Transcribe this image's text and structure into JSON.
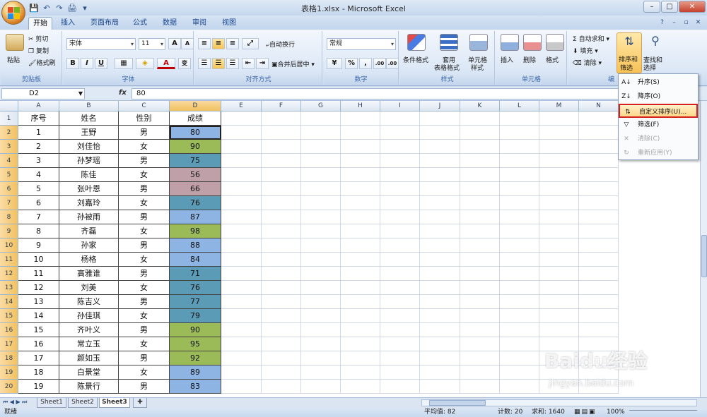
{
  "window": {
    "title": "表格1.xlsx - Microsoft Excel"
  },
  "tabs": [
    "开始",
    "插入",
    "页面布局",
    "公式",
    "数据",
    "审阅",
    "视图"
  ],
  "ribbon": {
    "clipboard": {
      "label": "剪贴板",
      "paste": "粘贴",
      "cut": "剪切",
      "copy": "复制",
      "format_painter": "格式刷"
    },
    "font": {
      "label": "字体",
      "name": "宋体",
      "size": "11",
      "bold": "B",
      "italic": "I",
      "underline": "U",
      "grow": "A",
      "shrink": "A",
      "color_letter": "A",
      "phonetic": "变"
    },
    "alignment": {
      "label": "对齐方式",
      "wrap": "自动换行",
      "merge": "合并后居中"
    },
    "number": {
      "label": "数字",
      "format": "常规",
      "percent": "%",
      "comma": ",",
      "inc_decimal": ".00",
      "dec_decimal": ".00"
    },
    "styles": {
      "label": "样式",
      "conditional": "条件格式",
      "table_line1": "套用",
      "table_line2": "表格格式",
      "cell_line1": "单元格",
      "cell_line2": "样式"
    },
    "cells": {
      "label": "单元格",
      "insert": "插入",
      "delete": "删除",
      "format": "格式"
    },
    "editing": {
      "label": "编",
      "autosum": "自动求和",
      "fill": "填充",
      "clear": "清除",
      "sort_line1": "排序和",
      "sort_line2": "筛选",
      "find_line1": "查找和",
      "find_line2": "选择"
    }
  },
  "formula_bar": {
    "name_box": "D2",
    "fx": "fx",
    "value": "80"
  },
  "columns": [
    "A",
    "B",
    "C",
    "D",
    "E",
    "F",
    "G",
    "H",
    "I",
    "J",
    "K",
    "L",
    "M",
    "N"
  ],
  "headers": [
    "序号",
    "姓名",
    "性别",
    "成绩"
  ],
  "rows": [
    {
      "n": "1",
      "name": "王野",
      "sex": "男",
      "score": "80",
      "color": "#8eb4e3"
    },
    {
      "n": "2",
      "name": "刘佳怡",
      "sex": "女",
      "score": "90",
      "color": "#9bbb59"
    },
    {
      "n": "3",
      "name": "孙梦瑶",
      "sex": "男",
      "score": "75",
      "color": "#5b9bb5"
    },
    {
      "n": "4",
      "name": "陈佳",
      "sex": "女",
      "score": "56",
      "color": "#c0a0a8"
    },
    {
      "n": "5",
      "name": "张叶恩",
      "sex": "男",
      "score": "66",
      "color": "#c0a0a8"
    },
    {
      "n": "6",
      "name": "刘嘉玲",
      "sex": "女",
      "score": "76",
      "color": "#5b9bb5"
    },
    {
      "n": "7",
      "name": "孙被雨",
      "sex": "男",
      "score": "87",
      "color": "#8eb4e3"
    },
    {
      "n": "8",
      "name": "齐磊",
      "sex": "女",
      "score": "98",
      "color": "#9bbb59"
    },
    {
      "n": "9",
      "name": "孙家",
      "sex": "男",
      "score": "88",
      "color": "#8eb4e3"
    },
    {
      "n": "10",
      "name": "杨格",
      "sex": "女",
      "score": "84",
      "color": "#8eb4e3"
    },
    {
      "n": "11",
      "name": "高雅谁",
      "sex": "男",
      "score": "71",
      "color": "#5b9bb5"
    },
    {
      "n": "12",
      "name": "刘美",
      "sex": "女",
      "score": "76",
      "color": "#5b9bb5"
    },
    {
      "n": "13",
      "name": "陈吉义",
      "sex": "男",
      "score": "77",
      "color": "#5b9bb5"
    },
    {
      "n": "14",
      "name": "孙佳琪",
      "sex": "女",
      "score": "79",
      "color": "#5b9bb5"
    },
    {
      "n": "15",
      "name": "齐叶义",
      "sex": "男",
      "score": "90",
      "color": "#9bbb59"
    },
    {
      "n": "16",
      "name": "常立玉",
      "sex": "女",
      "score": "95",
      "color": "#9bbb59"
    },
    {
      "n": "17",
      "name": "颜如玉",
      "sex": "男",
      "score": "92",
      "color": "#9bbb59"
    },
    {
      "n": "18",
      "name": "白景堂",
      "sex": "女",
      "score": "89",
      "color": "#8eb4e3"
    },
    {
      "n": "19",
      "name": "陈景行",
      "sex": "男",
      "score": "83",
      "color": "#8eb4e3"
    }
  ],
  "sheets": [
    "Sheet1",
    "Sheet2",
    "Sheet3"
  ],
  "sort_menu": [
    {
      "label": "升序(S)",
      "icon": "A↓",
      "disabled": false,
      "highlight": false
    },
    {
      "label": "降序(O)",
      "icon": "Z↓",
      "disabled": false,
      "highlight": false
    },
    {
      "label": "自定义排序(U)...",
      "icon": "⇅",
      "disabled": false,
      "highlight": true
    },
    {
      "label": "筛选(F)",
      "icon": "▽",
      "disabled": false,
      "highlight": false
    },
    {
      "label": "清除(C)",
      "icon": "✕",
      "disabled": true,
      "highlight": false
    },
    {
      "label": "重新应用(Y)",
      "icon": "↻",
      "disabled": true,
      "highlight": false
    }
  ],
  "status": {
    "ready": "就绪",
    "average": "平均值: 82",
    "count": "计数: 20",
    "sum": "求和: 1640",
    "zoom": "100%"
  },
  "watermark": {
    "brand": "Baidu经验",
    "url": "jingyan.baidu.com"
  }
}
